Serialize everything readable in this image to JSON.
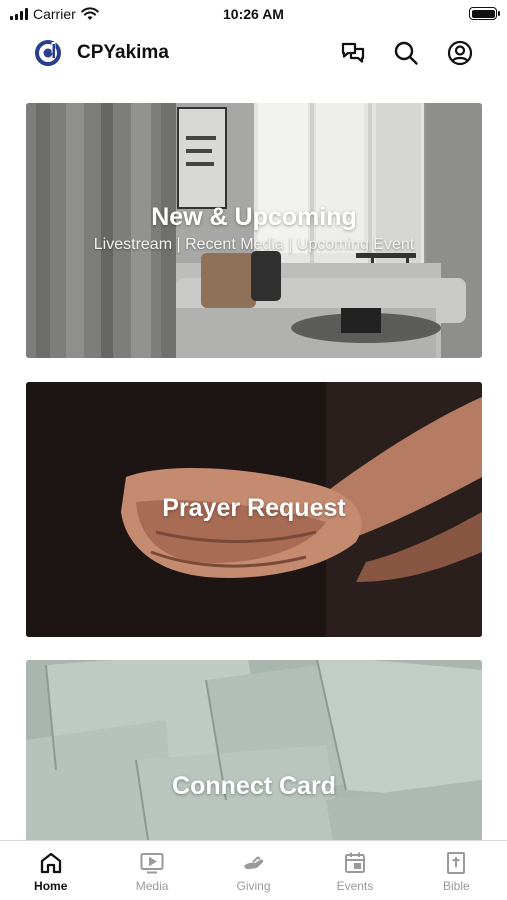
{
  "status_bar": {
    "carrier": "Carrier",
    "time": "10:26 AM"
  },
  "header": {
    "title": "CPYakima"
  },
  "icons": {
    "logo": "app-logo-icon",
    "chat": "chat-bubbles-icon",
    "search": "search-icon",
    "account": "user-circle-icon"
  },
  "cards": [
    {
      "title": "New & Upcoming",
      "subtitle": "Livestream | Recent Media | Upcoming Event"
    },
    {
      "title": "Prayer Request"
    },
    {
      "title": "Connect Card"
    }
  ],
  "tabs": [
    {
      "label": "Home",
      "icon": "home-icon",
      "active": true
    },
    {
      "label": "Media",
      "icon": "play-screen-icon",
      "active": false
    },
    {
      "label": "Giving",
      "icon": "giving-hand-icon",
      "active": false
    },
    {
      "label": "Events",
      "icon": "calendar-icon",
      "active": false
    },
    {
      "label": "Bible",
      "icon": "bible-book-icon",
      "active": false
    }
  ],
  "colors": {
    "brand": "#2b3d8f",
    "active_tab": "#111111",
    "inactive_tab": "#9a9a9a"
  }
}
